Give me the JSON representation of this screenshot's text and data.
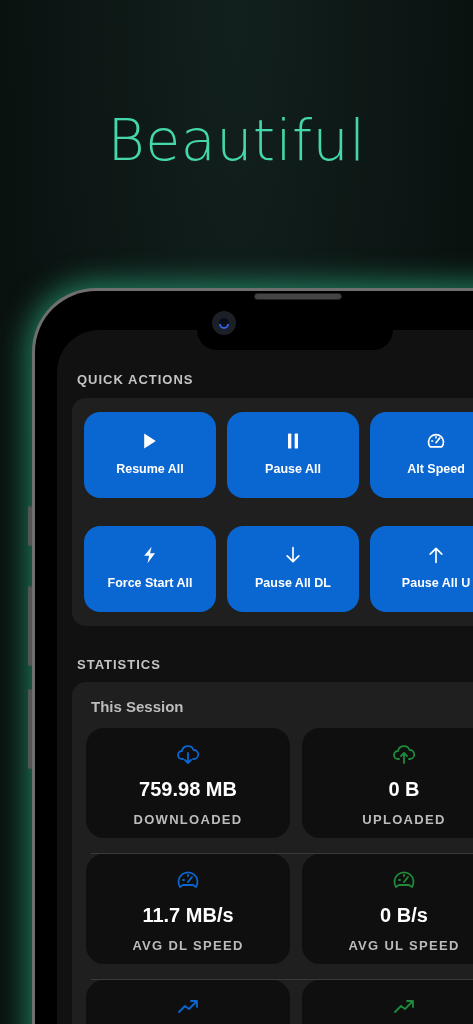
{
  "headline": "Beautiful",
  "quick_actions": {
    "title": "QUICK ACTIONS",
    "buttons": [
      {
        "kind": "play",
        "label": "Resume All"
      },
      {
        "kind": "pause",
        "label": "Pause All"
      },
      {
        "kind": "gauge",
        "label": "Alt Speed"
      },
      {
        "kind": "bolt",
        "label": "Force Start All"
      },
      {
        "kind": "down",
        "label": "Pause All DL"
      },
      {
        "kind": "up",
        "label": "Pause All U"
      }
    ]
  },
  "statistics": {
    "title": "STATISTICS",
    "card_title": "This Session",
    "rows": [
      {
        "kind": "transfer",
        "tiles": [
          {
            "color": "#0a66d0",
            "value": "759.98 MB",
            "label": "DOWNLOADED"
          },
          {
            "color": "#1f8a3a",
            "value": "0 B",
            "label": "UPLOADED"
          }
        ]
      },
      {
        "kind": "speed",
        "tiles": [
          {
            "color": "#0a66d0",
            "value": "11.7 MB/s",
            "label": "AVG DL SPEED"
          },
          {
            "color": "#1f8a3a",
            "value": "0 B/s",
            "label": "AVG UL SPEED"
          }
        ]
      },
      {
        "kind": "trend",
        "tiles": [
          {
            "color": "#0a66d0"
          },
          {
            "color": "#1f8a3a"
          }
        ]
      }
    ]
  }
}
